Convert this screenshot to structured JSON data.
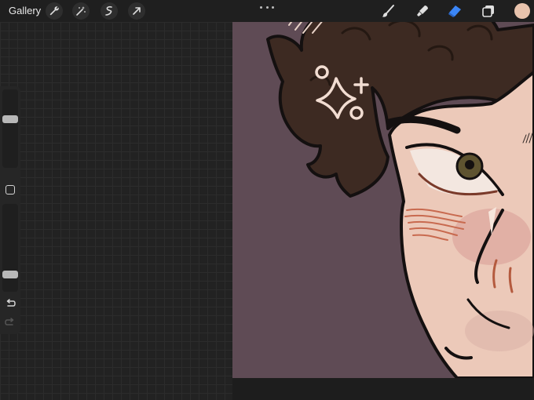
{
  "app": {
    "gallery_label": "Gallery"
  },
  "toolbar": {
    "left_tools": [
      "wrench-icon",
      "magic-wand-icon",
      "selection-icon",
      "transform-arrow-icon"
    ],
    "more_icon": "ellipsis-icon",
    "right_tools": [
      "brush-icon",
      "smudge-icon",
      "eraser-icon",
      "layers-icon"
    ],
    "active_tool": "eraser-icon",
    "active_color": "#e8c3ad"
  },
  "sidebar": {
    "brush_size_level": 0.63,
    "opacity_level": 0.15,
    "modify_icon": "square-modify-icon",
    "undo_icon": "undo-icon",
    "redo_icon": "redo-icon"
  },
  "colors": {
    "canvas_background": "#5f4b55",
    "hair": "#3d2a22",
    "skin": "#ecc9b9",
    "accent_blue": "#3b86f7"
  }
}
